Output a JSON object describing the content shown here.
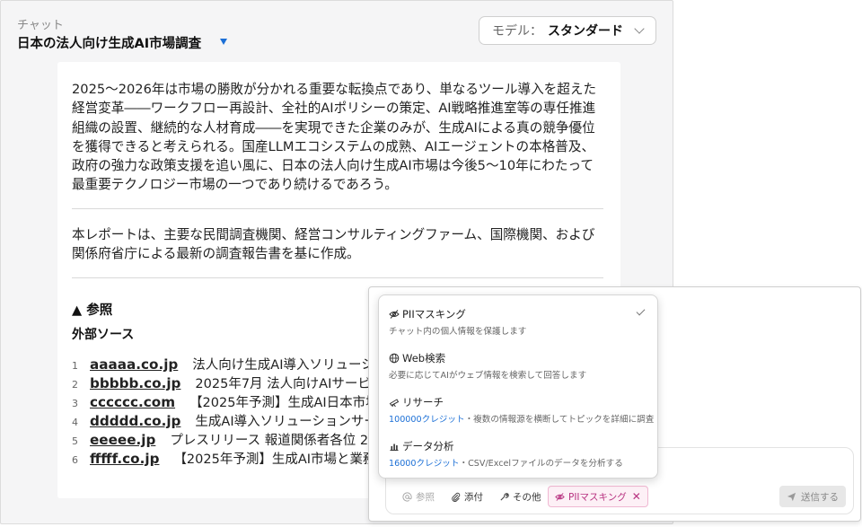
{
  "header": {
    "subtitle": "チャット",
    "title": "日本の法人向け生成AI市場調査"
  },
  "model_selector": {
    "label": "モデル：",
    "value": "スタンダード"
  },
  "report": {
    "paragraph1": "2025〜2026年は市場の勝敗が分かれる重要な転換点であり、単なるツール導入を超えた経営変革――ワークフロー再設計、全社的AIポリシーの策定、AI戦略推進室等の専任推進組織の設置、継続的な人材育成――を実現できた企業のみが、生成AIによる真の競争優位を獲得できると考えられる。国産LLMエコシステムの成熟、AIエージェントの本格普及、政府の強力な政策支援を追い風に、日本の法人向け生成AI市場は今後5〜10年にわたって最重要テクノロジー市場の一つであり続けるであろう。",
    "paragraph2": "本レポートは、主要な民間調査機関、経営コンサルティングファーム、国際機関、および関係府省庁による最新の調査報告書を基に作成。"
  },
  "references": {
    "heading": "▲ 参照",
    "external_heading": "外部ソース",
    "sources": [
      {
        "num": "1",
        "domain": "aaaaa.co.jp",
        "title": "法人向け生成AI導入ソリューシ"
      },
      {
        "num": "2",
        "domain": "bbbbb.co.jp",
        "title": "2025年7月 法人向けAIサービス"
      },
      {
        "num": "3",
        "domain": "cccccc.com",
        "title": "【2025年予測】生成AI日本市場"
      },
      {
        "num": "4",
        "domain": "ddddd.co.jp",
        "title": "生成AI導入ソリューションサー"
      },
      {
        "num": "5",
        "domain": "eeeee.jp",
        "title": "プレスリリース 報道関係者各位 20"
      },
      {
        "num": "6",
        "domain": "fffff.co.jp",
        "title": "【2025年予測】生成AI市場と業務"
      }
    ]
  },
  "menu": {
    "options": [
      {
        "name": "PIIマスキング",
        "credit": "",
        "desc": "チャット内の個人情報を保護します"
      },
      {
        "name": "Web検索",
        "credit": "",
        "desc": "必要に応じてAIがウェブ情報を検索して回答します"
      },
      {
        "name": "リサーチ",
        "credit": "100000クレジット",
        "desc": "・複数の情報源を横断してトピックを詳細に調査"
      },
      {
        "name": "データ分析",
        "credit": "16000クレジット",
        "desc": "・CSV/Excelファイルのデータを分析する"
      }
    ]
  },
  "toolbar": {
    "reference_label": "参照",
    "attach_label": "添付",
    "other_label": "その他",
    "pii_label": "PIIマスキング",
    "pii_close": "✕",
    "send_label": "送信する"
  },
  "colors": {
    "accent": "#1b6fd6",
    "pii_chip": "#b83280"
  }
}
